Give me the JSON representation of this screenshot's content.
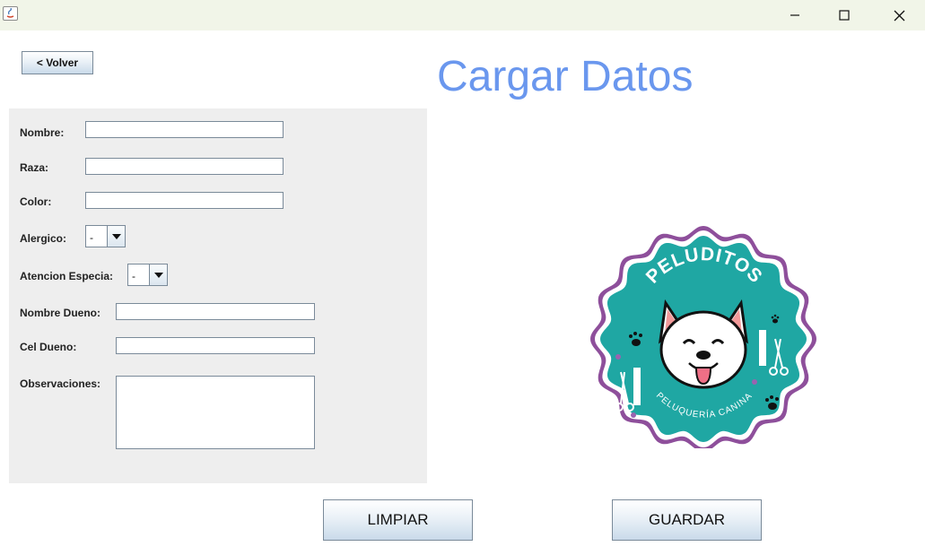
{
  "window": {
    "title": "",
    "controls": {
      "minimize": "minimize-icon",
      "maximize": "maximize-icon",
      "close": "close-icon"
    }
  },
  "header": {
    "back_label": "< Volver",
    "title": "Cargar Datos"
  },
  "form": {
    "nombre_label": "Nombre:",
    "nombre_value": "",
    "raza_label": "Raza:",
    "raza_value": "",
    "color_label": "Color:",
    "color_value": "",
    "alergico_label": "Alergico:",
    "alergico_value": "-",
    "atencion_label": "Atencion Especia:",
    "atencion_value": "-",
    "nombre_dueno_label": "Nombre Dueno:",
    "nombre_dueno_value": "",
    "cel_dueno_label": "Cel Dueno:",
    "cel_dueno_value": "",
    "observaciones_label": "Observaciones:",
    "observaciones_value": ""
  },
  "logo": {
    "brand": "PELUDITOS",
    "subtitle": "PELUQUERÍA CANINA",
    "colors": {
      "teal": "#1fa7a3",
      "border": "#8e4f9b",
      "paw": "#111111"
    }
  },
  "actions": {
    "clear_label": "LIMPIAR",
    "save_label": "GUARDAR"
  },
  "colors": {
    "title": "#6a97ee",
    "panel": "#eeeeee",
    "titlebar": "#f1f5e8"
  }
}
